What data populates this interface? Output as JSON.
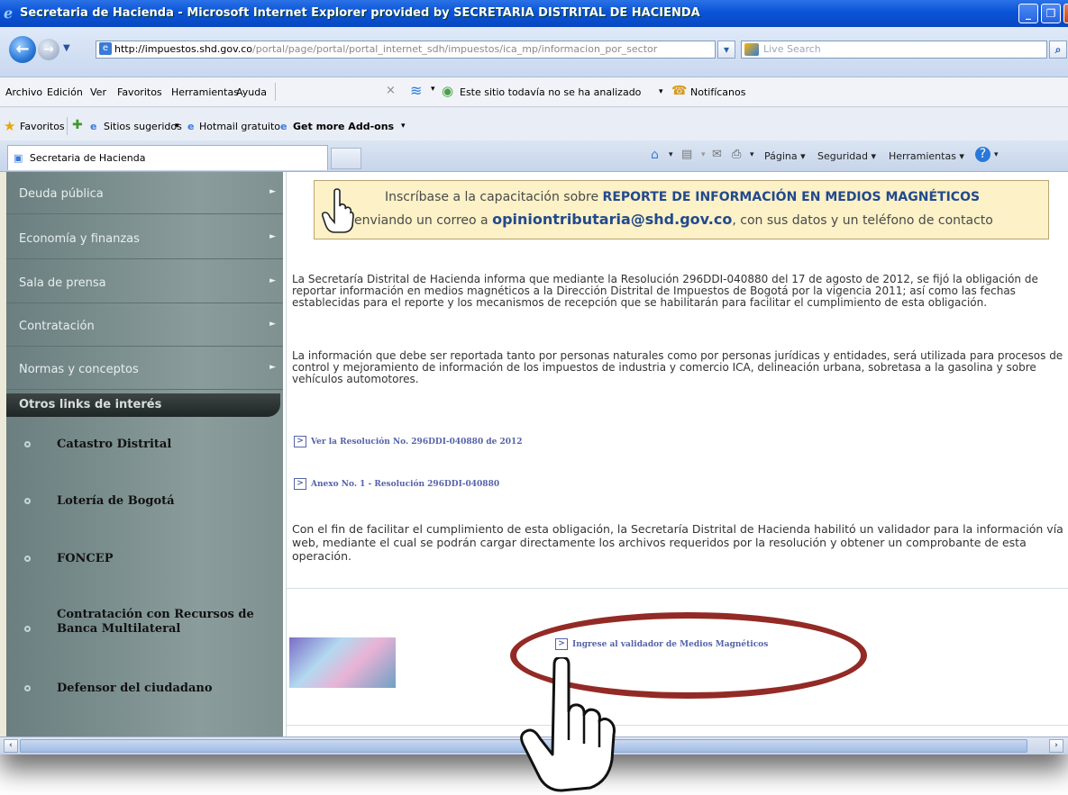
{
  "window": {
    "title": "Secretaria de Hacienda - Microsoft Internet Explorer provided by SECRETARIA DISTRITAL DE HACIENDA"
  },
  "address_bar": {
    "url_domain": "http://impuestos.shd.gov.co",
    "url_path": "/portal/page/portal/portal_internet_sdh/impuestos/ica_mp/informacion_por_sector",
    "search_placeholder": "Live Search"
  },
  "menu": {
    "items": [
      "Archivo",
      "Edición",
      "Ver",
      "Favoritos",
      "Herramientas",
      "Ayuda"
    ],
    "site_status": "Este sitio todavía no se ha analizado",
    "notify": "Notifícanos"
  },
  "favorites_bar": {
    "favorites": "Favoritos",
    "suggested": "Sitios sugeridos",
    "hotmail": "Hotmail gratuito",
    "addons": "Get more Add-ons"
  },
  "tabs": {
    "active_tab": "Secretaria de Hacienda",
    "commands": [
      "Página",
      "Seguridad",
      "Herramientas"
    ]
  },
  "sidebar": {
    "menu_items": [
      "Deuda pública",
      "Economía y finanzas",
      "Sala de prensa",
      "Contratación",
      "Normas y conceptos"
    ],
    "others_title": "Otros links de interés",
    "links": [
      "Catastro Distrital",
      "Lotería de Bogotá",
      "FONCEP",
      "Contratación con Recursos de Banca Multilateral",
      "Defensor del ciudadano"
    ]
  },
  "banner": {
    "line1_pre": "Inscríbase a la capacitación sobre ",
    "line1_bold": "REPORTE DE INFORMACIÓN EN MEDIOS MAGNÉTICOS",
    "line2_pre": "enviando un correo a ",
    "email": "opiniontributaria@shd.gov.co",
    "line2_post": ", con sus datos y un teléfono de contacto"
  },
  "content": {
    "para1": "La Secretaría Distrital de Hacienda informa que mediante la Resolución 296DDI-040880 del 17 de agosto de 2012, se fijó la obligación de reportar información en medios magnéticos a la Dirección Distrital de Impuestos de Bogotá por la vigencia 2011; así como las fechas establecidas para el reporte y los mecanismos de recepción que se habilitarán para facilitar el cumplimiento de esta obligación.",
    "para2": "La información que debe ser reportada tanto por personas naturales como por personas jurídicas y entidades, será utilizada para procesos de control y mejoramiento de información de los impuestos de industria y comercio ICA, delineación urbana, sobretasa a la gasolina y sobre vehículos automotores.",
    "link1": "Ver la Resolución No. 296DDI-040880 de 2012",
    "link2": "Anexo No. 1 - Resolución 296DDI-040880",
    "para3": "Con el fin de facilitar el cumplimiento de esta obligación, la Secretaría Distrital de Hacienda habilitó un validador para la información vía web, mediante el cual se podrán cargar directamente los archivos requeridos por la resolución y obtener un comprobante de esta operación.",
    "validator_link": "Ingrese al validador de Medios Magnéticos"
  },
  "colors": {
    "accent": "#224a8c",
    "highlight_ellipse": "#932a25",
    "sidebar": "#7f9190"
  }
}
